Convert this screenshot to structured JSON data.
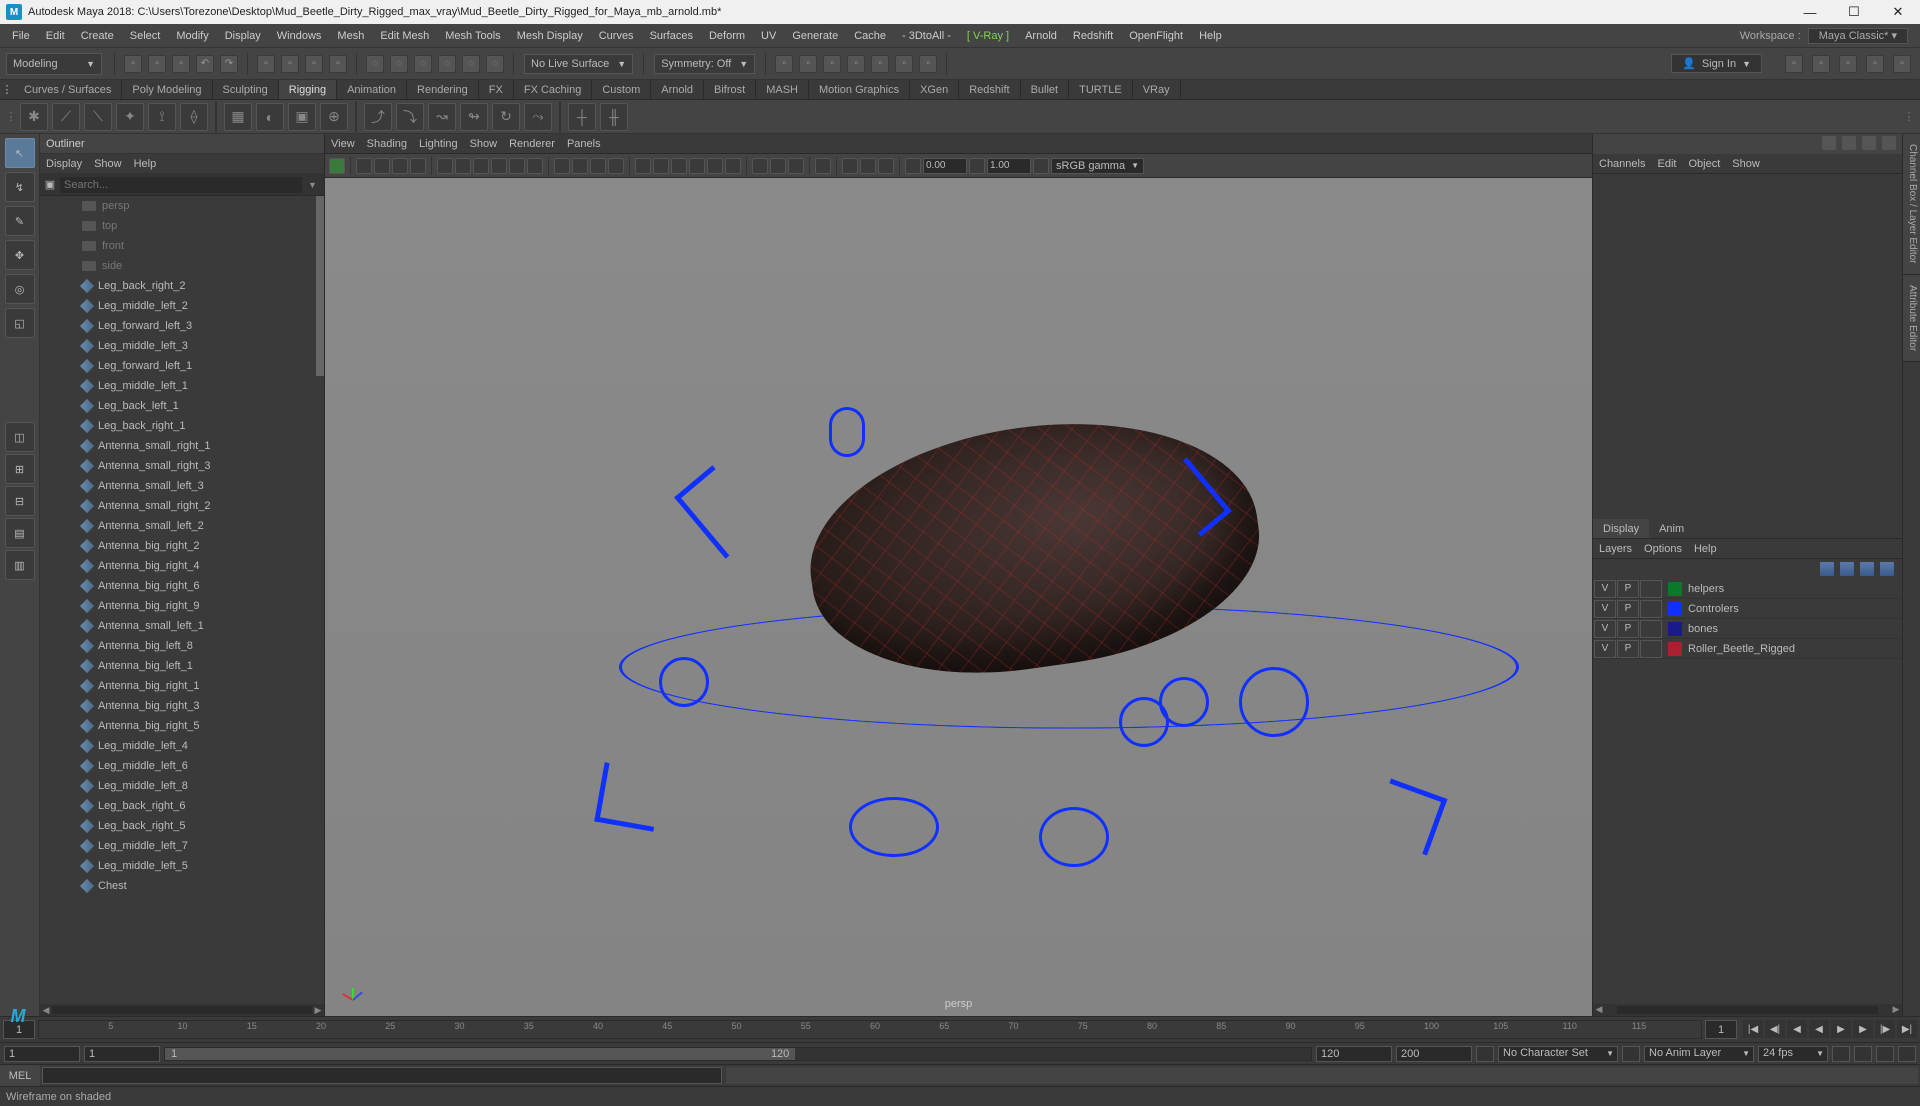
{
  "title": "Autodesk Maya 2018: C:\\Users\\Torezone\\Desktop\\Mud_Beetle_Dirty_Rigged_max_vray\\Mud_Beetle_Dirty_Rigged_for_Maya_mb_arnold.mb*",
  "mainmenu": [
    "File",
    "Edit",
    "Create",
    "Select",
    "Modify",
    "Display",
    "Windows",
    "Mesh",
    "Edit Mesh",
    "Mesh Tools",
    "Mesh Display",
    "Curves",
    "Surfaces",
    "Deform",
    "UV",
    "Generate",
    "Cache",
    "- 3DtoAll -",
    "[ V-Ray ]",
    "Arnold",
    "Redshift",
    "OpenFlight",
    "Help"
  ],
  "workspace_label": "Workspace :",
  "workspace_value": "Maya Classic*",
  "mode": "Modeling",
  "live_surface": "No Live Surface",
  "symmetry": "Symmetry: Off",
  "signin": "Sign In",
  "tabs": [
    "Curves / Surfaces",
    "Poly Modeling",
    "Sculpting",
    "Rigging",
    "Animation",
    "Rendering",
    "FX",
    "FX Caching",
    "Custom",
    "Arnold",
    "Bifrost",
    "MASH",
    "Motion Graphics",
    "XGen",
    "Redshift",
    "Bullet",
    "TURTLE",
    "VRay"
  ],
  "active_tab": "Rigging",
  "outliner": {
    "title": "Outliner",
    "menu": [
      "Display",
      "Show",
      "Help"
    ],
    "search_placeholder": "Search...",
    "cameras": [
      "persp",
      "top",
      "front",
      "side"
    ],
    "nodes": [
      "Leg_back_right_2",
      "Leg_middle_left_2",
      "Leg_forward_left_3",
      "Leg_middle_left_3",
      "Leg_forward_left_1",
      "Leg_middle_left_1",
      "Leg_back_left_1",
      "Leg_back_right_1",
      "Antenna_small_right_1",
      "Antenna_small_right_3",
      "Antenna_small_left_3",
      "Antenna_small_right_2",
      "Antenna_small_left_2",
      "Antenna_big_right_2",
      "Antenna_big_right_4",
      "Antenna_big_right_6",
      "Antenna_big_right_9",
      "Antenna_small_left_1",
      "Antenna_big_left_8",
      "Antenna_big_left_1",
      "Antenna_big_right_1",
      "Antenna_big_right_3",
      "Antenna_big_right_5",
      "Leg_middle_left_4",
      "Leg_middle_left_6",
      "Leg_middle_left_8",
      "Leg_back_right_6",
      "Leg_back_right_5",
      "Leg_middle_left_7",
      "Leg_middle_left_5",
      "Chest"
    ]
  },
  "viewport": {
    "menu": [
      "View",
      "Shading",
      "Lighting",
      "Show",
      "Renderer",
      "Panels"
    ],
    "field1": "0.00",
    "field2": "1.00",
    "colorspace": "sRGB gamma",
    "camera": "persp"
  },
  "right": {
    "menu1": [
      "Channels",
      "Edit",
      "Object",
      "Show"
    ],
    "tabs2": [
      "Display",
      "Anim"
    ],
    "active_tab2": "Display",
    "menu2": [
      "Layers",
      "Options",
      "Help"
    ],
    "layers": [
      {
        "v": "V",
        "p": "P",
        "color": "#0a7a2a",
        "name": "helpers"
      },
      {
        "v": "V",
        "p": "P",
        "color": "#1030ff",
        "name": "Controlers"
      },
      {
        "v": "V",
        "p": "P",
        "color": "#1a1a8a",
        "name": "bones"
      },
      {
        "v": "V",
        "p": "P",
        "color": "#aa2030",
        "name": "Roller_Beetle_Rigged"
      }
    ],
    "side_tabs": [
      "Channel Box / Layer Editor",
      "Attribute Editor"
    ]
  },
  "timeline": {
    "cur": "1",
    "cur2": "1",
    "ticks": [
      "5",
      "10",
      "15",
      "20",
      "25",
      "30",
      "35",
      "40",
      "45",
      "50",
      "55",
      "60",
      "65",
      "70",
      "75",
      "80",
      "85",
      "90",
      "95",
      "100",
      "105",
      "110",
      "115"
    ]
  },
  "range": {
    "start_out": "1",
    "start_in": "1",
    "label_in": "1",
    "end_in": "120",
    "end_out": "120",
    "end_out2": "200",
    "charset": "No Character Set",
    "animlayer": "No Anim Layer",
    "fps": "24 fps"
  },
  "mel": "MEL",
  "status": "Wireframe on shaded"
}
